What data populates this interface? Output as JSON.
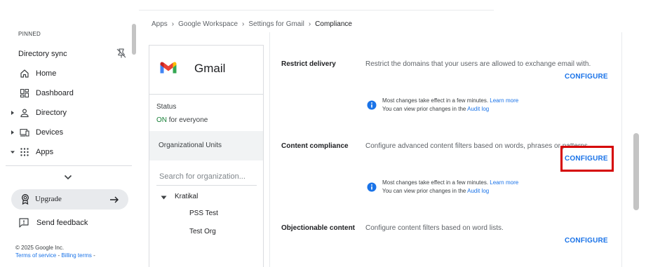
{
  "nav": {
    "pinned_label": "PINNED",
    "directory_sync": "Directory sync",
    "items": [
      {
        "label": "Home",
        "icon": "home-icon"
      },
      {
        "label": "Dashboard",
        "icon": "dashboard-icon"
      },
      {
        "label": "Directory",
        "icon": "person-icon"
      },
      {
        "label": "Devices",
        "icon": "devices-icon"
      },
      {
        "label": "Apps",
        "icon": "apps-grid-icon"
      }
    ],
    "upgrade_label": "Upgrade",
    "feedback_label": "Send feedback",
    "copyright": "© 2025 Google Inc.",
    "terms": "Terms of service",
    "billing": "Billing terms",
    "legal_sep": " - "
  },
  "breadcrumb": {
    "items": [
      "Apps",
      "Google Workspace",
      "Settings for Gmail"
    ],
    "current": "Compliance"
  },
  "app": {
    "name": "Gmail",
    "status_label": "Status",
    "status_on": "ON",
    "status_rest": " for everyone",
    "ou_header": "Organizational Units",
    "search_placeholder": "Search for organization...",
    "tree_root": "Kratikal",
    "tree_children": [
      "PSS Test",
      "Test Org"
    ]
  },
  "settings": {
    "rows": [
      {
        "title": "Restrict delivery",
        "desc": "Restrict the domains that your users are allowed to exchange email with.",
        "action": "CONFIGURE"
      },
      {
        "title": "Content compliance",
        "desc": "Configure advanced content filters based on words, phrases or patterns.",
        "action": "CONFIGURE"
      },
      {
        "title": "Objectionable content",
        "desc": "Configure content filters based on word lists.",
        "action": "CONFIGURE"
      }
    ],
    "note": {
      "line1": "Most changes take effect in a few minutes.",
      "learn_more": "Learn more",
      "line2": "You can view prior changes in the",
      "audit_log": "Audit log"
    }
  },
  "colors": {
    "accent": "#1a73e8",
    "highlight": "#d50000",
    "on_green": "#188038"
  }
}
